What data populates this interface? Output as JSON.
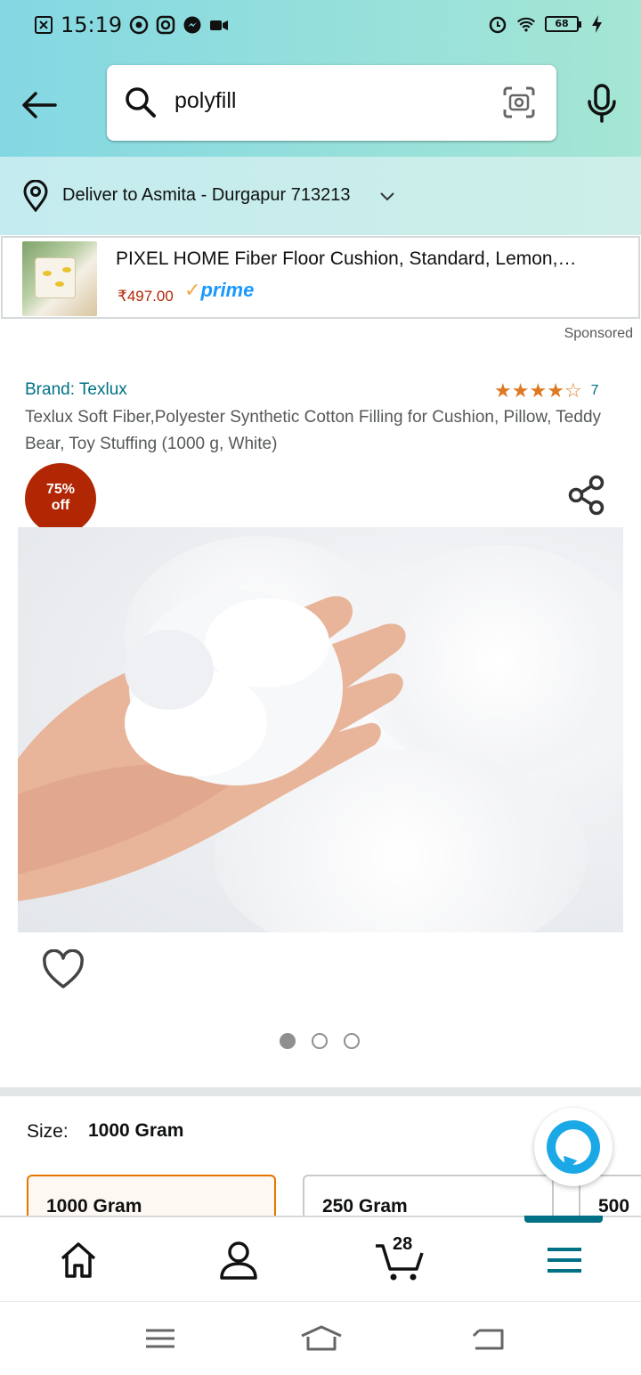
{
  "status_bar": {
    "time": "15:19",
    "battery": "68"
  },
  "search": {
    "value": "polyfill"
  },
  "delivery": {
    "text": "Deliver to Asmita - Durgapur 713213"
  },
  "sponsored_product": {
    "title": "PIXEL HOME Fiber Floor Cushion, Standard, Lemon,…",
    "price": "₹497.00",
    "prime_label": "prime",
    "sponsored_label": "Sponsored"
  },
  "product": {
    "brand": "Brand: Texlux",
    "rating_stars": 4,
    "rating_count": "7",
    "title": "Texlux Soft Fiber,Polyester Synthetic Cotton Filling for Cushion, Pillow, Teddy Bear, Toy Stuffing (1000 g, White)",
    "discount_line1": "75%",
    "discount_line2": "off",
    "image_count": 3,
    "active_image": 0
  },
  "size": {
    "label": "Size:",
    "selected": "1000 Gram",
    "options": [
      "1000 Gram",
      "250 Gram",
      "500"
    ]
  },
  "bottom_nav": {
    "items": [
      "home-icon",
      "account-icon",
      "cart-icon",
      "menu-icon"
    ],
    "cart_count": "28",
    "active": "menu-icon"
  },
  "colors": {
    "header_gradient_start": "#84d8e3",
    "header_gradient_end": "#a5e6d4",
    "link": "#007185",
    "price": "#b12704",
    "star": "#de7921",
    "discount_badge": "#b12704",
    "selected_border": "#e77600"
  }
}
